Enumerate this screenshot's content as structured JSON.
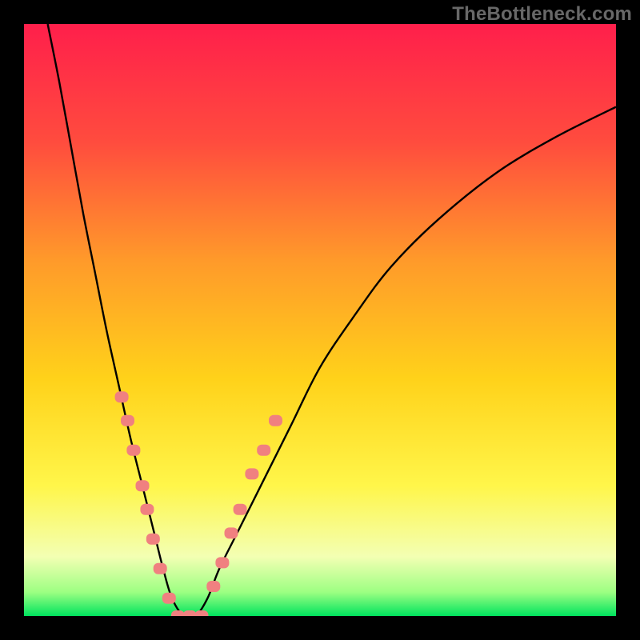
{
  "watermark": "TheBottleneck.com",
  "chart_data": {
    "type": "line",
    "title": "",
    "xlabel": "",
    "ylabel": "",
    "xlim": [
      0,
      100
    ],
    "ylim": [
      0,
      100
    ],
    "grid": false,
    "legend": false,
    "background_gradient_stops": [
      {
        "offset": 0.0,
        "color": "#ff1f4b"
      },
      {
        "offset": 0.2,
        "color": "#ff4c3e"
      },
      {
        "offset": 0.4,
        "color": "#ff9a2a"
      },
      {
        "offset": 0.6,
        "color": "#ffd21a"
      },
      {
        "offset": 0.78,
        "color": "#fff64a"
      },
      {
        "offset": 0.9,
        "color": "#f3ffb3"
      },
      {
        "offset": 0.96,
        "color": "#9cff82"
      },
      {
        "offset": 1.0,
        "color": "#00e35e"
      }
    ],
    "series": [
      {
        "name": "bottleneck-curve",
        "stroke": "#000000",
        "x": [
          4,
          6,
          8,
          10,
          12,
          14,
          16,
          18,
          20,
          22,
          23.5,
          25,
          27,
          29,
          31,
          33,
          36,
          40,
          45,
          50,
          56,
          62,
          70,
          80,
          90,
          100
        ],
        "y": [
          100,
          90,
          79,
          68,
          58,
          48,
          39,
          30,
          22,
          14,
          8,
          3,
          0,
          0,
          3,
          8,
          14,
          22,
          32,
          42,
          51,
          59,
          67,
          75,
          81,
          86
        ]
      }
    ],
    "markers": {
      "name": "highlighted-points",
      "color": "#f08080",
      "shape": "rounded-rect",
      "points": [
        {
          "x": 16.5,
          "y": 37
        },
        {
          "x": 17.5,
          "y": 33
        },
        {
          "x": 18.5,
          "y": 28
        },
        {
          "x": 20.0,
          "y": 22
        },
        {
          "x": 20.8,
          "y": 18
        },
        {
          "x": 21.8,
          "y": 13
        },
        {
          "x": 23.0,
          "y": 8
        },
        {
          "x": 24.5,
          "y": 3
        },
        {
          "x": 26.0,
          "y": 0
        },
        {
          "x": 28.0,
          "y": 0
        },
        {
          "x": 30.0,
          "y": 0
        },
        {
          "x": 32.0,
          "y": 5
        },
        {
          "x": 33.5,
          "y": 9
        },
        {
          "x": 35.0,
          "y": 14
        },
        {
          "x": 36.5,
          "y": 18
        },
        {
          "x": 38.5,
          "y": 24
        },
        {
          "x": 40.5,
          "y": 28
        },
        {
          "x": 42.5,
          "y": 33
        }
      ]
    }
  }
}
